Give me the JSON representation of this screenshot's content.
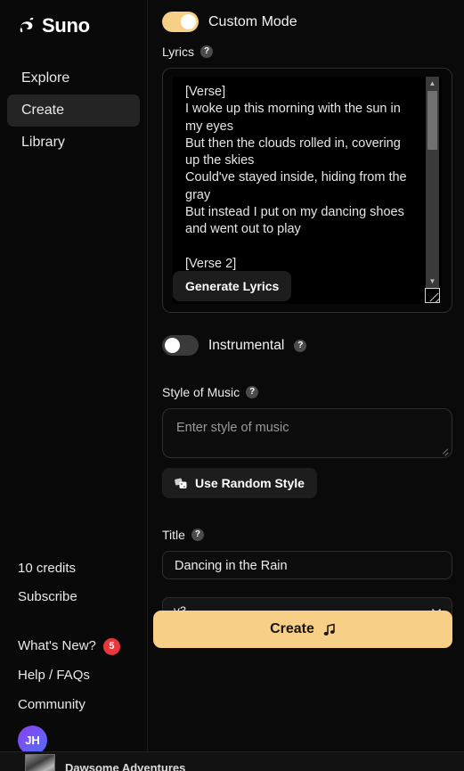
{
  "brand": {
    "name": "Suno",
    "logo_icon": "suno-wave-logo"
  },
  "sidebar": {
    "nav": [
      {
        "label": "Explore",
        "active": false
      },
      {
        "label": "Create",
        "active": true
      },
      {
        "label": "Library",
        "active": false
      }
    ],
    "credits": "10 credits",
    "subscribe": "Subscribe",
    "whats_new": {
      "label": "What's New?",
      "badge": "5",
      "badge_color": "#e8383d"
    },
    "help_faqs": "Help / FAQs",
    "community": "Community",
    "avatar": {
      "initials": "JH"
    }
  },
  "main": {
    "custom_mode": {
      "label": "Custom Mode",
      "on": true
    },
    "lyrics": {
      "label": "Lyrics",
      "help_icon": "help-circle-icon",
      "value": "[Verse]\nI woke up this morning with the sun in my eyes\nBut then the clouds rolled in, covering up the skies\nCould've stayed inside, hiding from the gray\nBut instead I put on my dancing shoes and went out to play\n\n[Verse 2]",
      "generate_button": "Generate Lyrics"
    },
    "instrumental": {
      "label": "Instrumental",
      "on": false,
      "help_icon": "help-circle-icon"
    },
    "style_of_music": {
      "label": "Style of Music",
      "placeholder": "Enter style of music",
      "value": "",
      "help_icon": "help-circle-icon",
      "random_button": "Use Random Style",
      "random_icon": "dice-icon"
    },
    "title": {
      "label": "Title",
      "value": "Dancing in the Rain",
      "help_icon": "help-circle-icon"
    },
    "model_select": {
      "value": "v3",
      "chevron_icon": "chevron-down-icon"
    },
    "create_button": {
      "label": "Create",
      "icon": "music-note-icon",
      "color": "#f8cf87"
    }
  },
  "player": {
    "track_title": "Dawsome Adventures"
  }
}
